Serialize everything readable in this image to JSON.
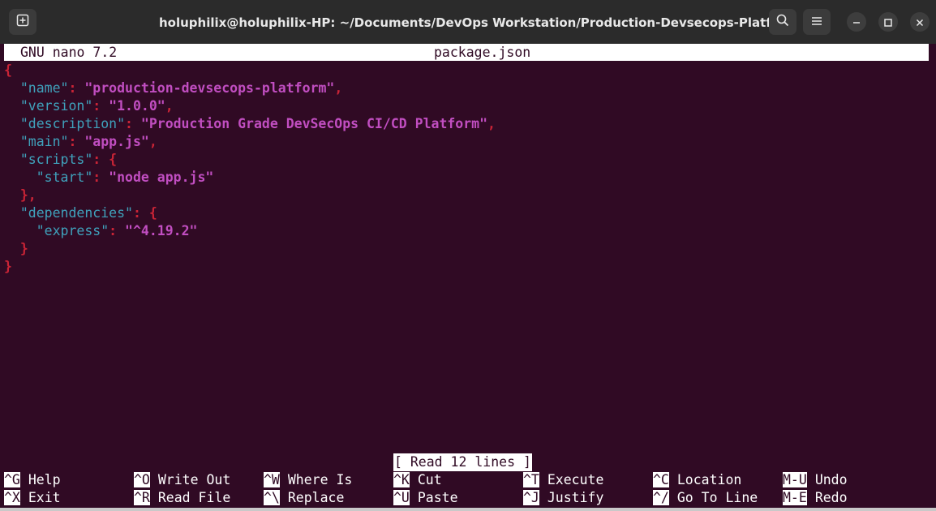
{
  "window": {
    "title": "holuphilix@holuphilix-HP: ~/Documents/DevOps Workstation/Production-Devsecops-Platform/app"
  },
  "nano": {
    "version": "GNU nano 7.2",
    "filename": "package.json",
    "status": "[ Read 12 lines ]",
    "lines": [
      [
        {
          "t": "{",
          "c": "p"
        }
      ],
      [
        {
          "t": "  "
        },
        {
          "t": "\"name\"",
          "c": "k"
        },
        {
          "t": ": ",
          "c": "p"
        },
        {
          "t": "\"production-devsecops-platform\"",
          "c": "s"
        },
        {
          "t": ",",
          "c": "p"
        }
      ],
      [
        {
          "t": "  "
        },
        {
          "t": "\"version\"",
          "c": "k"
        },
        {
          "t": ": ",
          "c": "p"
        },
        {
          "t": "\"1.0.0\"",
          "c": "s"
        },
        {
          "t": ",",
          "c": "p"
        }
      ],
      [
        {
          "t": "  "
        },
        {
          "t": "\"description\"",
          "c": "k"
        },
        {
          "t": ": ",
          "c": "p"
        },
        {
          "t": "\"Production Grade DevSecOps CI/CD Platform\"",
          "c": "s"
        },
        {
          "t": ",",
          "c": "p"
        }
      ],
      [
        {
          "t": "  "
        },
        {
          "t": "\"main\"",
          "c": "k"
        },
        {
          "t": ": ",
          "c": "p"
        },
        {
          "t": "\"app.js\"",
          "c": "s"
        },
        {
          "t": ",",
          "c": "p"
        }
      ],
      [
        {
          "t": "  "
        },
        {
          "t": "\"scripts\"",
          "c": "k"
        },
        {
          "t": ": {",
          "c": "p"
        }
      ],
      [
        {
          "t": "    "
        },
        {
          "t": "\"start\"",
          "c": "k"
        },
        {
          "t": ": ",
          "c": "p"
        },
        {
          "t": "\"node app.js\"",
          "c": "s"
        }
      ],
      [
        {
          "t": "  "
        },
        {
          "t": "},",
          "c": "p"
        }
      ],
      [
        {
          "t": "  "
        },
        {
          "t": "\"dependencies\"",
          "c": "k"
        },
        {
          "t": ": {",
          "c": "p"
        }
      ],
      [
        {
          "t": "    "
        },
        {
          "t": "\"express\"",
          "c": "k"
        },
        {
          "t": ": ",
          "c": "p"
        },
        {
          "t": "\"^4.19.2\"",
          "c": "s"
        }
      ],
      [
        {
          "t": "  "
        },
        {
          "t": "}",
          "c": "p"
        }
      ],
      [
        {
          "t": "}",
          "c": "p"
        }
      ]
    ],
    "shortcuts": [
      {
        "key": "^G",
        "label": "Help"
      },
      {
        "key": "^X",
        "label": "Exit"
      },
      {
        "key": "^O",
        "label": "Write Out"
      },
      {
        "key": "^R",
        "label": "Read File"
      },
      {
        "key": "^W",
        "label": "Where Is"
      },
      {
        "key": "^\\",
        "label": "Replace"
      },
      {
        "key": "^K",
        "label": "Cut"
      },
      {
        "key": "^U",
        "label": "Paste"
      },
      {
        "key": "^T",
        "label": "Execute"
      },
      {
        "key": "^J",
        "label": "Justify"
      },
      {
        "key": "^C",
        "label": "Location"
      },
      {
        "key": "^/",
        "label": "Go To Line"
      },
      {
        "key": "M-U",
        "label": "Undo"
      },
      {
        "key": "M-E",
        "label": "Redo"
      }
    ]
  },
  "icons": {
    "new_tab": "new-tab-icon",
    "search": "search-icon",
    "menu": "hamburger-menu-icon",
    "minimize": "minimize-icon",
    "maximize": "maximize-icon",
    "close": "close-icon"
  },
  "colors": {
    "terminal_bg": "#300a24",
    "titlebar_bg": "#2b2b2b",
    "key_color": "#3fa2bc",
    "string_color": "#c14ec1",
    "punct_color": "#c92436"
  }
}
